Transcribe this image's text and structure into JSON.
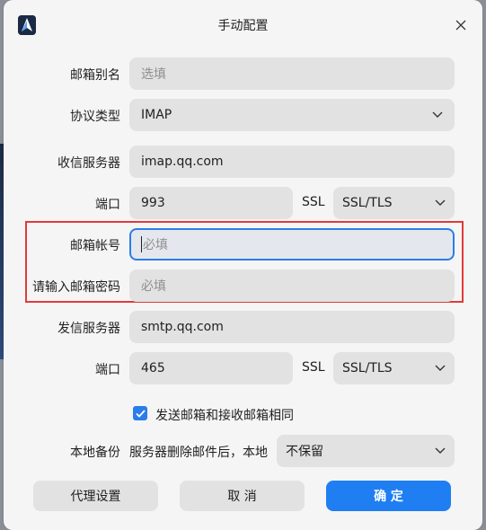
{
  "window": {
    "title": "手动配置"
  },
  "form": {
    "alias": {
      "label": "邮箱别名",
      "placeholder": "选填"
    },
    "protocol": {
      "label": "协议类型",
      "value": "IMAP"
    },
    "incoming_server": {
      "label": "收信服务器",
      "value": "imap.qq.com"
    },
    "incoming_port": {
      "label": "端口",
      "value": "993",
      "ssl_label": "SSL",
      "ssl_value": "SSL/TLS"
    },
    "account": {
      "label": "邮箱帐号",
      "placeholder": "必填"
    },
    "password": {
      "label": "请输入邮箱密码",
      "placeholder": "必填"
    },
    "outgoing_server": {
      "label": "发信服务器",
      "value": "smtp.qq.com"
    },
    "outgoing_port": {
      "label": "端口",
      "value": "465",
      "ssl_label": "SSL",
      "ssl_value": "SSL/TLS"
    },
    "same_account": {
      "label": "发送邮箱和接收邮箱相同",
      "checked": true
    },
    "backup": {
      "label": "本地备份",
      "description": "服务器删除邮件后，本地",
      "value": "不保留"
    }
  },
  "buttons": {
    "proxy": "代理设置",
    "cancel": "取 消",
    "ok": "确 定"
  },
  "colors": {
    "accent": "#1e7ef2",
    "focus_border": "#2b7de9",
    "highlight_box": "#e23a3a"
  }
}
